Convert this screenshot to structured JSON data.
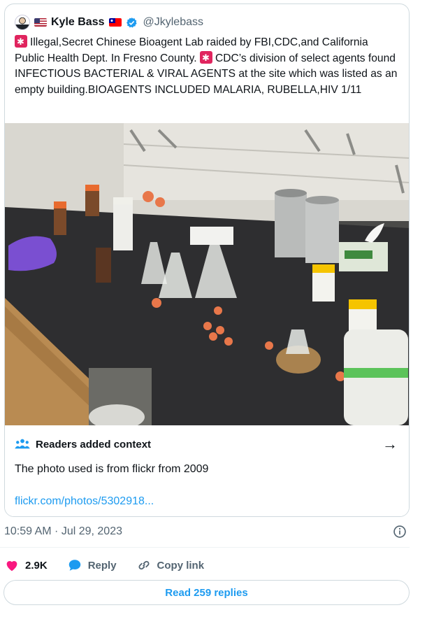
{
  "author": {
    "name": "Kyle Bass",
    "handle": "@Jkylebass",
    "flag_left": "us-flag",
    "flag_right": "taiwan-flag",
    "verified_color": "#1d9bf0"
  },
  "tweet": {
    "text_part1": "Illegal,Secret Chinese Bioagent Lab raided by FBI,CDC,and California Public Health Dept. In Fresno County. ",
    "text_part2": "CDC’s division of select agents found INFECTIOUS BACTERIAL & VIRAL AGENTS at the site which was listed as an empty building.BIOAGENTS INCLUDED MALARIA, RUBELLA,HIV 1/11"
  },
  "context": {
    "title": "Readers added context",
    "body": "The photo used is from flickr from 2009",
    "link": "flickr.com/photos/5302918..."
  },
  "timestamp": "10:59 AM · Jul 29, 2023",
  "actions": {
    "likes": "2.9K",
    "reply_label": "Reply",
    "copy_link_label": "Copy link"
  },
  "read_replies": "Read 259 replies",
  "colors": {
    "accent": "#1d9bf0",
    "like": "#f91880",
    "muted": "#536471",
    "border": "#cfd9de"
  }
}
